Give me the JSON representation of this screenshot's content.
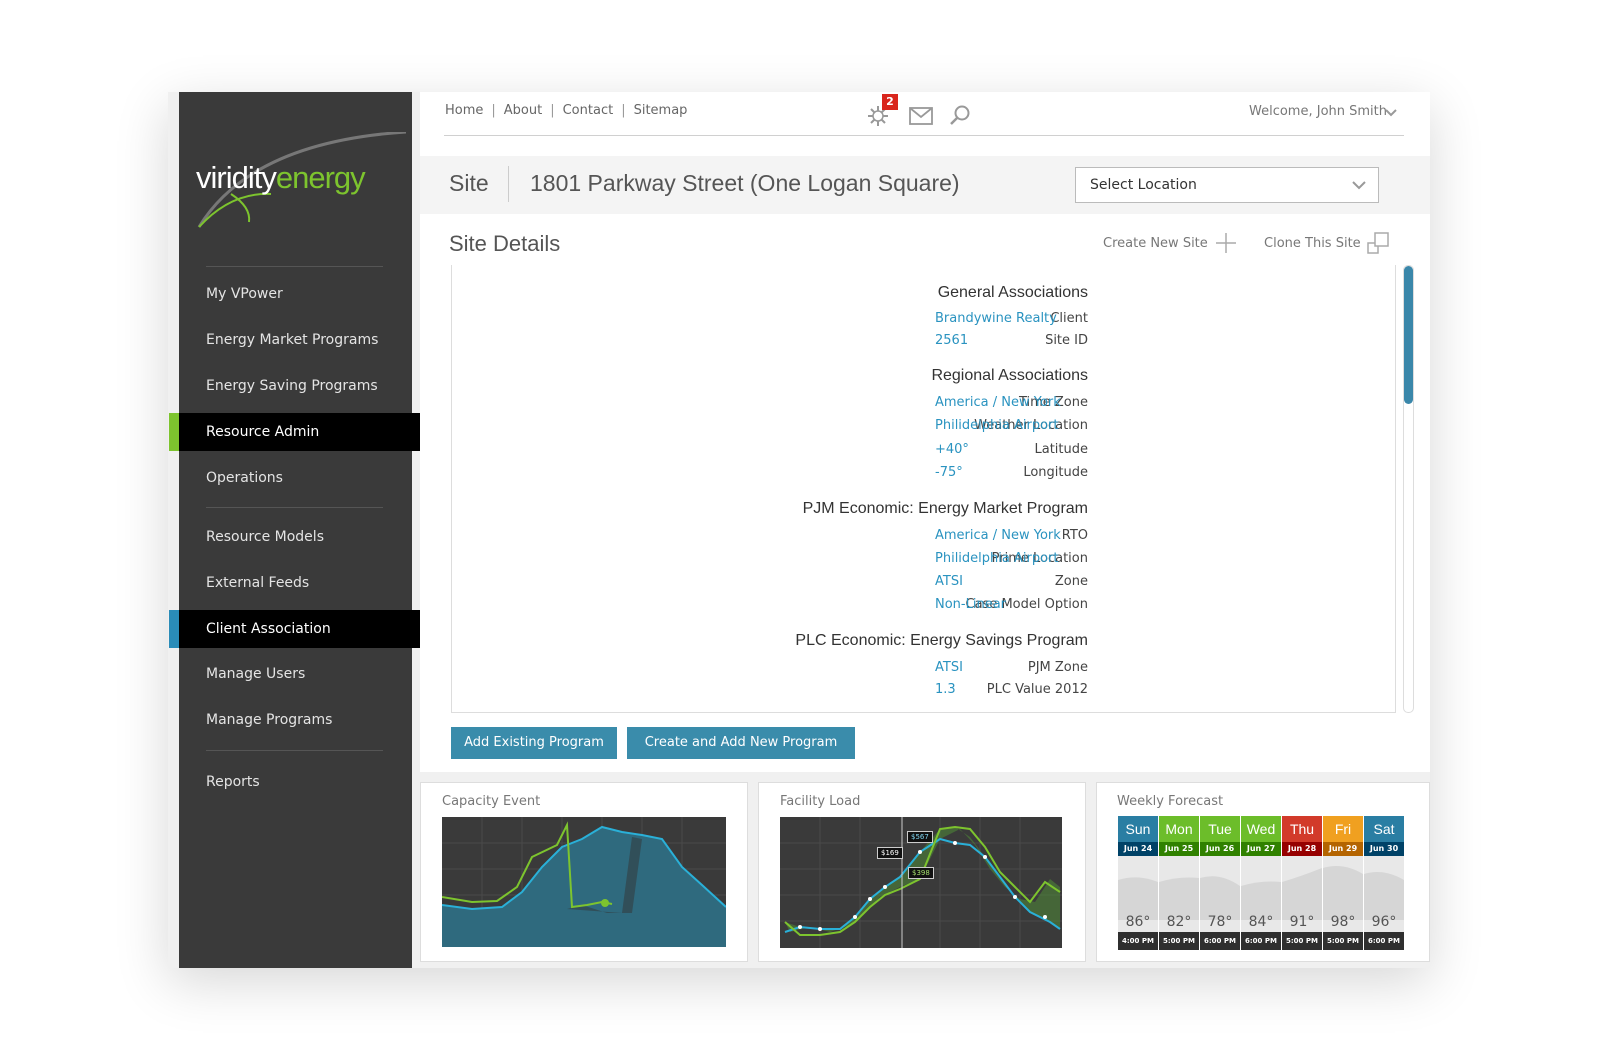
{
  "brand": {
    "logo_part1": "viridity",
    "logo_part2": "energy",
    "accent": "#7dc42e",
    "link_color": "#2a93c0"
  },
  "topnav": {
    "links": [
      "Home",
      "About",
      "Contact",
      "Sitemap"
    ],
    "notification_count": "2",
    "welcome": "Welcome, John Smith"
  },
  "sidebar": {
    "items": [
      {
        "label": "My VPower"
      },
      {
        "label": "Energy Market Programs"
      },
      {
        "label": "Energy Saving Programs"
      },
      {
        "label": "Resource Admin"
      },
      {
        "label": "Operations"
      },
      {
        "label": "Resource Models"
      },
      {
        "label": "External Feeds"
      },
      {
        "label": "Client Association"
      },
      {
        "label": "Manage Users"
      },
      {
        "label": "Manage Programs"
      },
      {
        "label": "Reports"
      }
    ]
  },
  "site": {
    "label": "Site",
    "name": "1801 Parkway Street (One Logan Square)",
    "select_location": "Select Location"
  },
  "details": {
    "title": "Site Details",
    "create_new": "Create New Site",
    "clone": "Clone This Site",
    "sections": [
      {
        "title": "General Associations",
        "rows": [
          {
            "label": "Client",
            "value": "Brandywine Realty"
          },
          {
            "label": "Site ID",
            "value": "2561"
          }
        ]
      },
      {
        "title": "Regional Associations",
        "rows": [
          {
            "label": "Time Zone",
            "value": "America / New York"
          },
          {
            "label": "Weather Location",
            "value": "Philidelphia Airport"
          },
          {
            "label": "Latitude",
            "value": "+40°"
          },
          {
            "label": "Longitude",
            "value": "-75°"
          }
        ]
      },
      {
        "title": "PJM Economic: Energy Market Program",
        "rows": [
          {
            "label": "RTO",
            "value": "America / New York"
          },
          {
            "label": "Prime Location",
            "value": "Philidelphia Airport"
          },
          {
            "label": "Zone",
            "value": "ATSI"
          },
          {
            "label": "Case Model Option",
            "value": "Non-Linear"
          }
        ]
      },
      {
        "title": "PLC Economic: Energy Savings Program",
        "rows": [
          {
            "label": "PJM Zone",
            "value": "ATSI"
          },
          {
            "label": "PLC Value 2012",
            "value": "1.3"
          }
        ]
      }
    ],
    "add_existing": "Add Existing Program",
    "create_add": "Create and Add New Program"
  },
  "widgets": {
    "capacity_title": "Capacity Event",
    "facility_title": "Facility Load",
    "forecast_title": "Weekly Forecast",
    "facility_labels": [
      "$567",
      "$169",
      "$398"
    ]
  },
  "forecast": [
    {
      "day": "Sun",
      "date": "Jun 24",
      "temp": "86°",
      "time": "4:00 PM",
      "color": "#2a7ea3"
    },
    {
      "day": "Mon",
      "date": "Jun 25",
      "temp": "82°",
      "time": "5:00 PM",
      "color": "#6cbd2a"
    },
    {
      "day": "Tue",
      "date": "Jun 26",
      "temp": "78°",
      "time": "6:00 PM",
      "color": "#6cbd2a"
    },
    {
      "day": "Wed",
      "date": "Jun 27",
      "temp": "84°",
      "time": "6:00 PM",
      "color": "#6cbd2a"
    },
    {
      "day": "Thu",
      "date": "Jun 28",
      "temp": "91°",
      "time": "5:00 PM",
      "color": "#d23a2a"
    },
    {
      "day": "Fri",
      "date": "Jun 29",
      "temp": "98°",
      "time": "5:00 PM",
      "color": "#f0a020"
    },
    {
      "day": "Sat",
      "date": "Jun 30",
      "temp": "96°",
      "time": "6:00 PM",
      "color": "#2a7ea3"
    }
  ]
}
